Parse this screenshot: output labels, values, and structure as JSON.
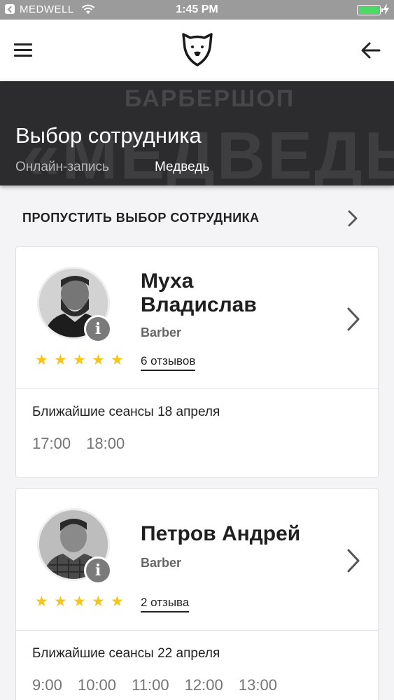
{
  "status_bar": {
    "carrier": "MEDWELL",
    "time": "1:45 PM"
  },
  "nav": {
    "menu_icon": "hamburger-icon",
    "logo_icon": "bear-logo-icon",
    "back_icon": "arrow-left-icon"
  },
  "hero": {
    "watermark_top": "БАРБЕРШОП",
    "watermark_big": "«МЕДВЕДЬ»",
    "title": "Выбор сотрудника",
    "subtitle_left": "Онлайн-запись",
    "subtitle_right": "Медведь"
  },
  "skip": {
    "label": "ПРОПУСТИТЬ ВЫБОР СОТРУДНИКА"
  },
  "employees": [
    {
      "name_line1": "Муха",
      "name_line2": "Владислав",
      "role": "Barber",
      "reviews": "6 отзывов",
      "rating": 5,
      "sessions_title": "Ближайшие сеансы 18 апреля",
      "slots": [
        "17:00",
        "18:00"
      ]
    },
    {
      "name_line1": "Петров Андрей",
      "role": "Barber",
      "reviews": "2 отзыва",
      "rating": 5,
      "sessions_title": "Ближайшие сеансы 22 апреля",
      "slots": [
        "9:00",
        "10:00",
        "11:00",
        "12:00",
        "13:00"
      ]
    }
  ],
  "colors": {
    "star": "#f5c518",
    "hero_bg": "#2c2c2e",
    "status_bar": "#9b9b9b"
  }
}
